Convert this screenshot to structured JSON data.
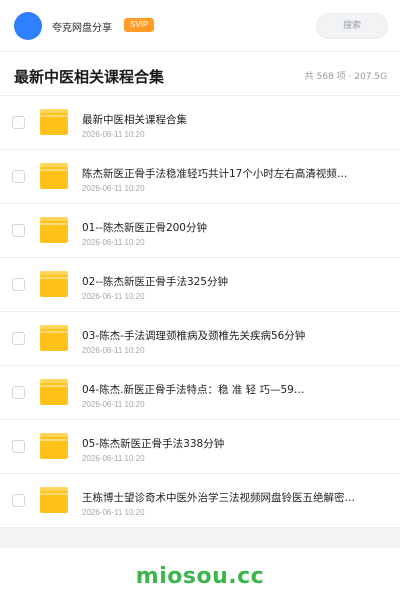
{
  "header": {
    "app_name": "夸克网盘分享",
    "badge": "SVIP",
    "search_placeholder": "搜索",
    "avatar_color": "#2f80ff",
    "badge_color": "#ff9c27"
  },
  "share": {
    "title": "最新中医相关课程合集",
    "summary": "共 568 项 · 207.5G"
  },
  "files": [
    {
      "name": "最新中医相关课程合集",
      "date": "2026-06-11 10:20",
      "icon": "folder-icon"
    },
    {
      "name": "陈杰新医正骨手法稳准轻巧共计17个小时左右高清视频…",
      "date": "2026-06-11 10:20",
      "icon": "folder-icon"
    },
    {
      "name": "01--陈杰新医正骨200分钟",
      "date": "2026-06-11 10:20",
      "icon": "folder-icon"
    },
    {
      "name": "02--陈杰新医正骨手法325分钟",
      "date": "2026-06-11 10:20",
      "icon": "folder-icon"
    },
    {
      "name": "03-陈杰-手法调理颈椎病及颈椎先关疾病56分钟",
      "date": "2026-06-11 10:20",
      "icon": "folder-icon"
    },
    {
      "name": "04-陈杰.新医正骨手法特点：稳 准 轻 巧—59…",
      "date": "2026-06-11 10:20",
      "icon": "folder-icon"
    },
    {
      "name": "05-陈杰新医正骨手法338分钟",
      "date": "2026-06-11 10:20",
      "icon": "folder-icon"
    },
    {
      "name": "王栋博士望诊奇术中医外治学三法视频网盘铃医五绝解密…",
      "date": "2026-06-11 10:20",
      "icon": "folder-icon"
    }
  ],
  "footer": {
    "domain": "miosou.cc",
    "domain_color": "#3cb64c"
  }
}
